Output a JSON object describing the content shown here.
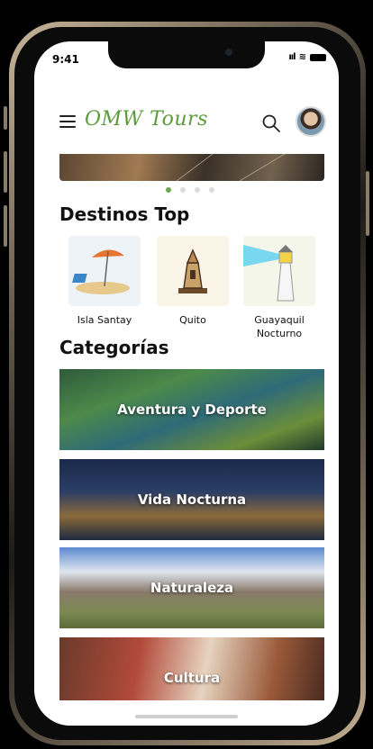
{
  "status_bar": {
    "time": "9:41",
    "signal": "ııl",
    "wifi": "≋"
  },
  "header": {
    "logo": "OMW Tours"
  },
  "carousel": {
    "dot_count": 4,
    "active_index": 0,
    "accent": "#6aa84f"
  },
  "destinos": {
    "title": "Destinos Top",
    "items": [
      {
        "label": "Isla Santay"
      },
      {
        "label": "Quito"
      },
      {
        "label": "Guayaquil Nocturno"
      }
    ]
  },
  "categorias": {
    "title": "Categorías",
    "items": [
      {
        "label": "Aventura y Deporte"
      },
      {
        "label": "Vida Nocturna"
      },
      {
        "label": "Naturaleza"
      },
      {
        "label": "Cultura"
      }
    ]
  }
}
